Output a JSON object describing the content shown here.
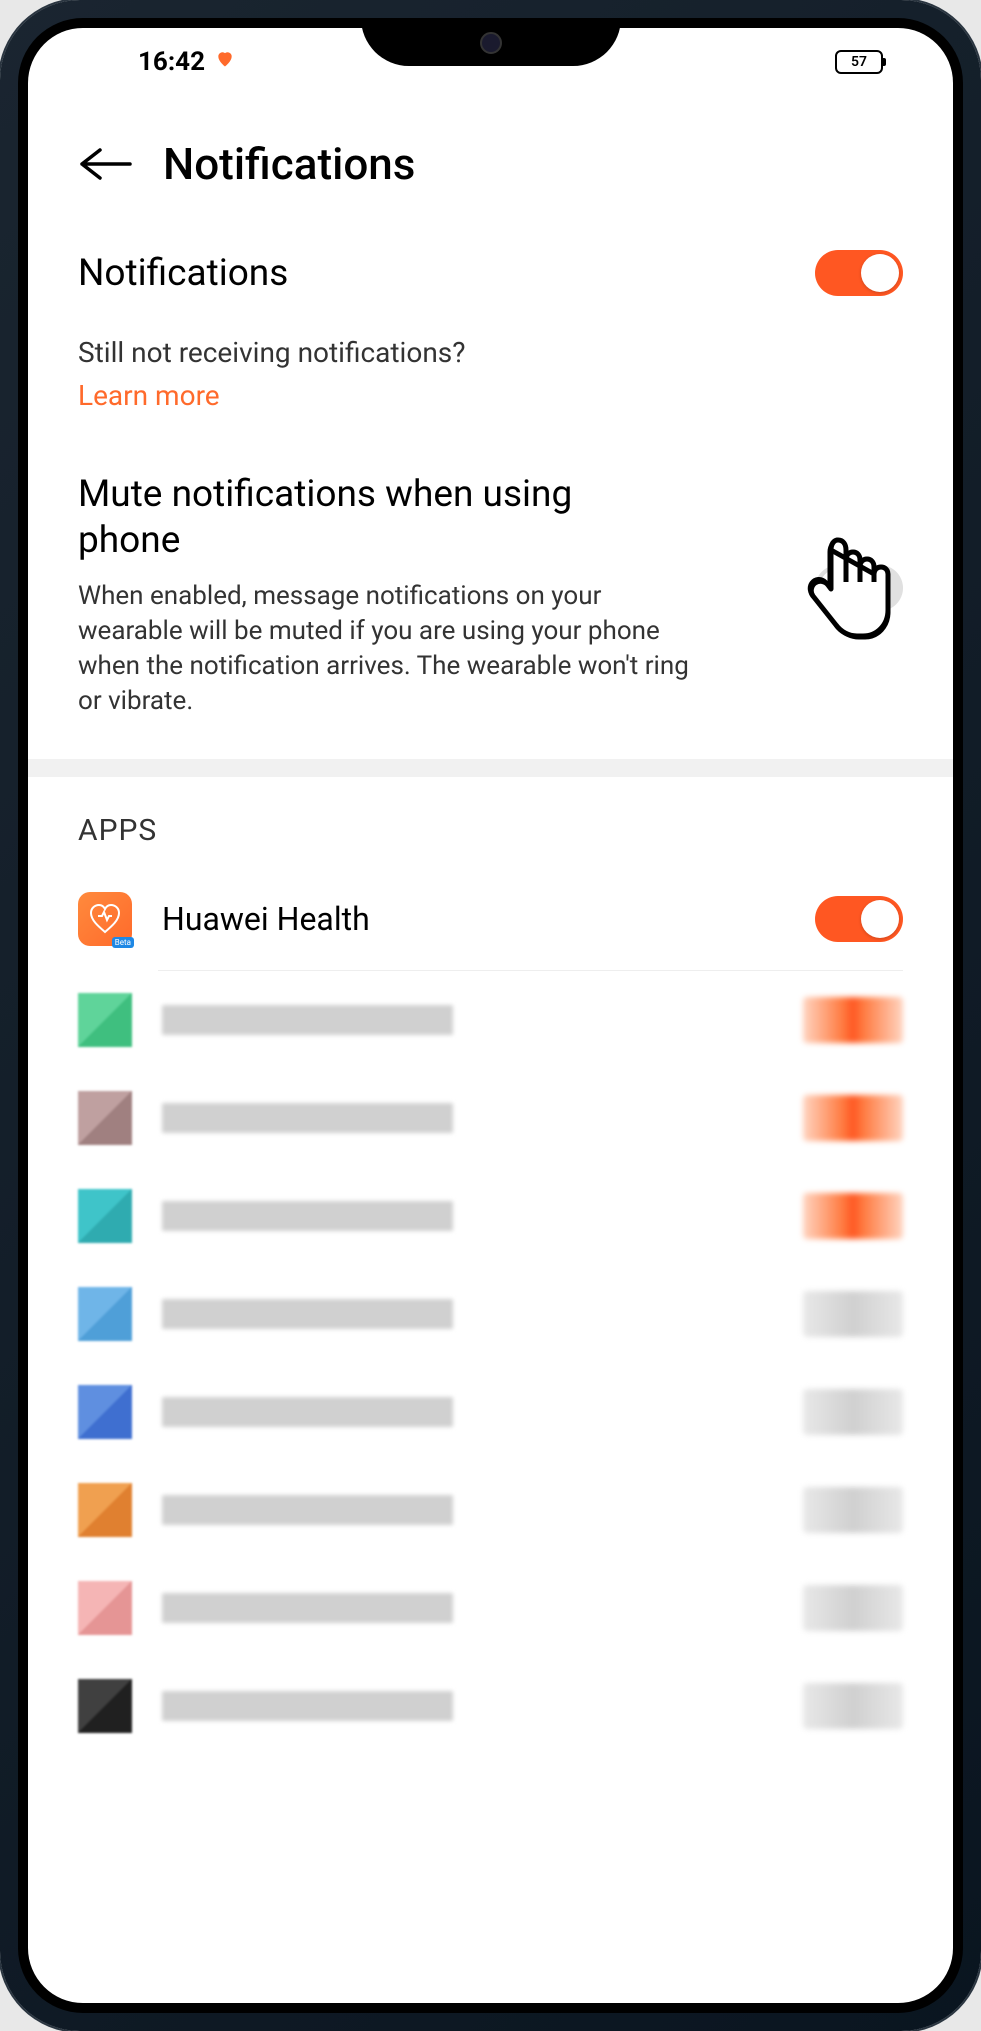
{
  "status": {
    "time": "16:42",
    "battery": "57"
  },
  "header": {
    "title": "Notifications"
  },
  "notifications": {
    "title": "Notifications",
    "enabled": true,
    "hint": "Still not receiving notifications?",
    "learn_more": "Learn more"
  },
  "mute": {
    "title": "Mute notifications when using phone",
    "description": "When enabled, message notifications on your wearable will be muted if you are using your phone when the notification arrives. The wearable won't ring or vibrate.",
    "enabled": false
  },
  "apps": {
    "header": "APPS",
    "items": [
      {
        "name": "Huawei Health",
        "enabled": true,
        "icon": "health"
      }
    ],
    "obscured_items": [
      {
        "icon_color_a": "#5fd49a",
        "icon_color_b": "#3fbf7f",
        "text_width": 160,
        "toggle_on": true
      },
      {
        "icon_color_a": "#bfa0a0",
        "icon_color_b": "#a08080",
        "text_width": 100,
        "toggle_on": true
      },
      {
        "icon_color_a": "#3fc4c9",
        "icon_color_b": "#2fabb0",
        "text_width": 200,
        "toggle_on": true
      },
      {
        "icon_color_a": "#6fb5e8",
        "icon_color_b": "#4f9fd8",
        "text_width": 120,
        "toggle_on": false
      },
      {
        "icon_color_a": "#5f8fe0",
        "icon_color_b": "#3f6fd0",
        "text_width": 130,
        "toggle_on": false
      },
      {
        "icon_color_a": "#f0a050",
        "icon_color_b": "#e08030",
        "text_width": 140,
        "toggle_on": false
      },
      {
        "icon_color_a": "#f5b5b5",
        "icon_color_b": "#e59595",
        "text_width": 150,
        "toggle_on": false
      },
      {
        "icon_color_a": "#404040",
        "icon_color_b": "#202020",
        "text_width": 110,
        "toggle_on": false
      }
    ]
  },
  "colors": {
    "accent": "#ff5722",
    "link": "#ff6a2b"
  }
}
